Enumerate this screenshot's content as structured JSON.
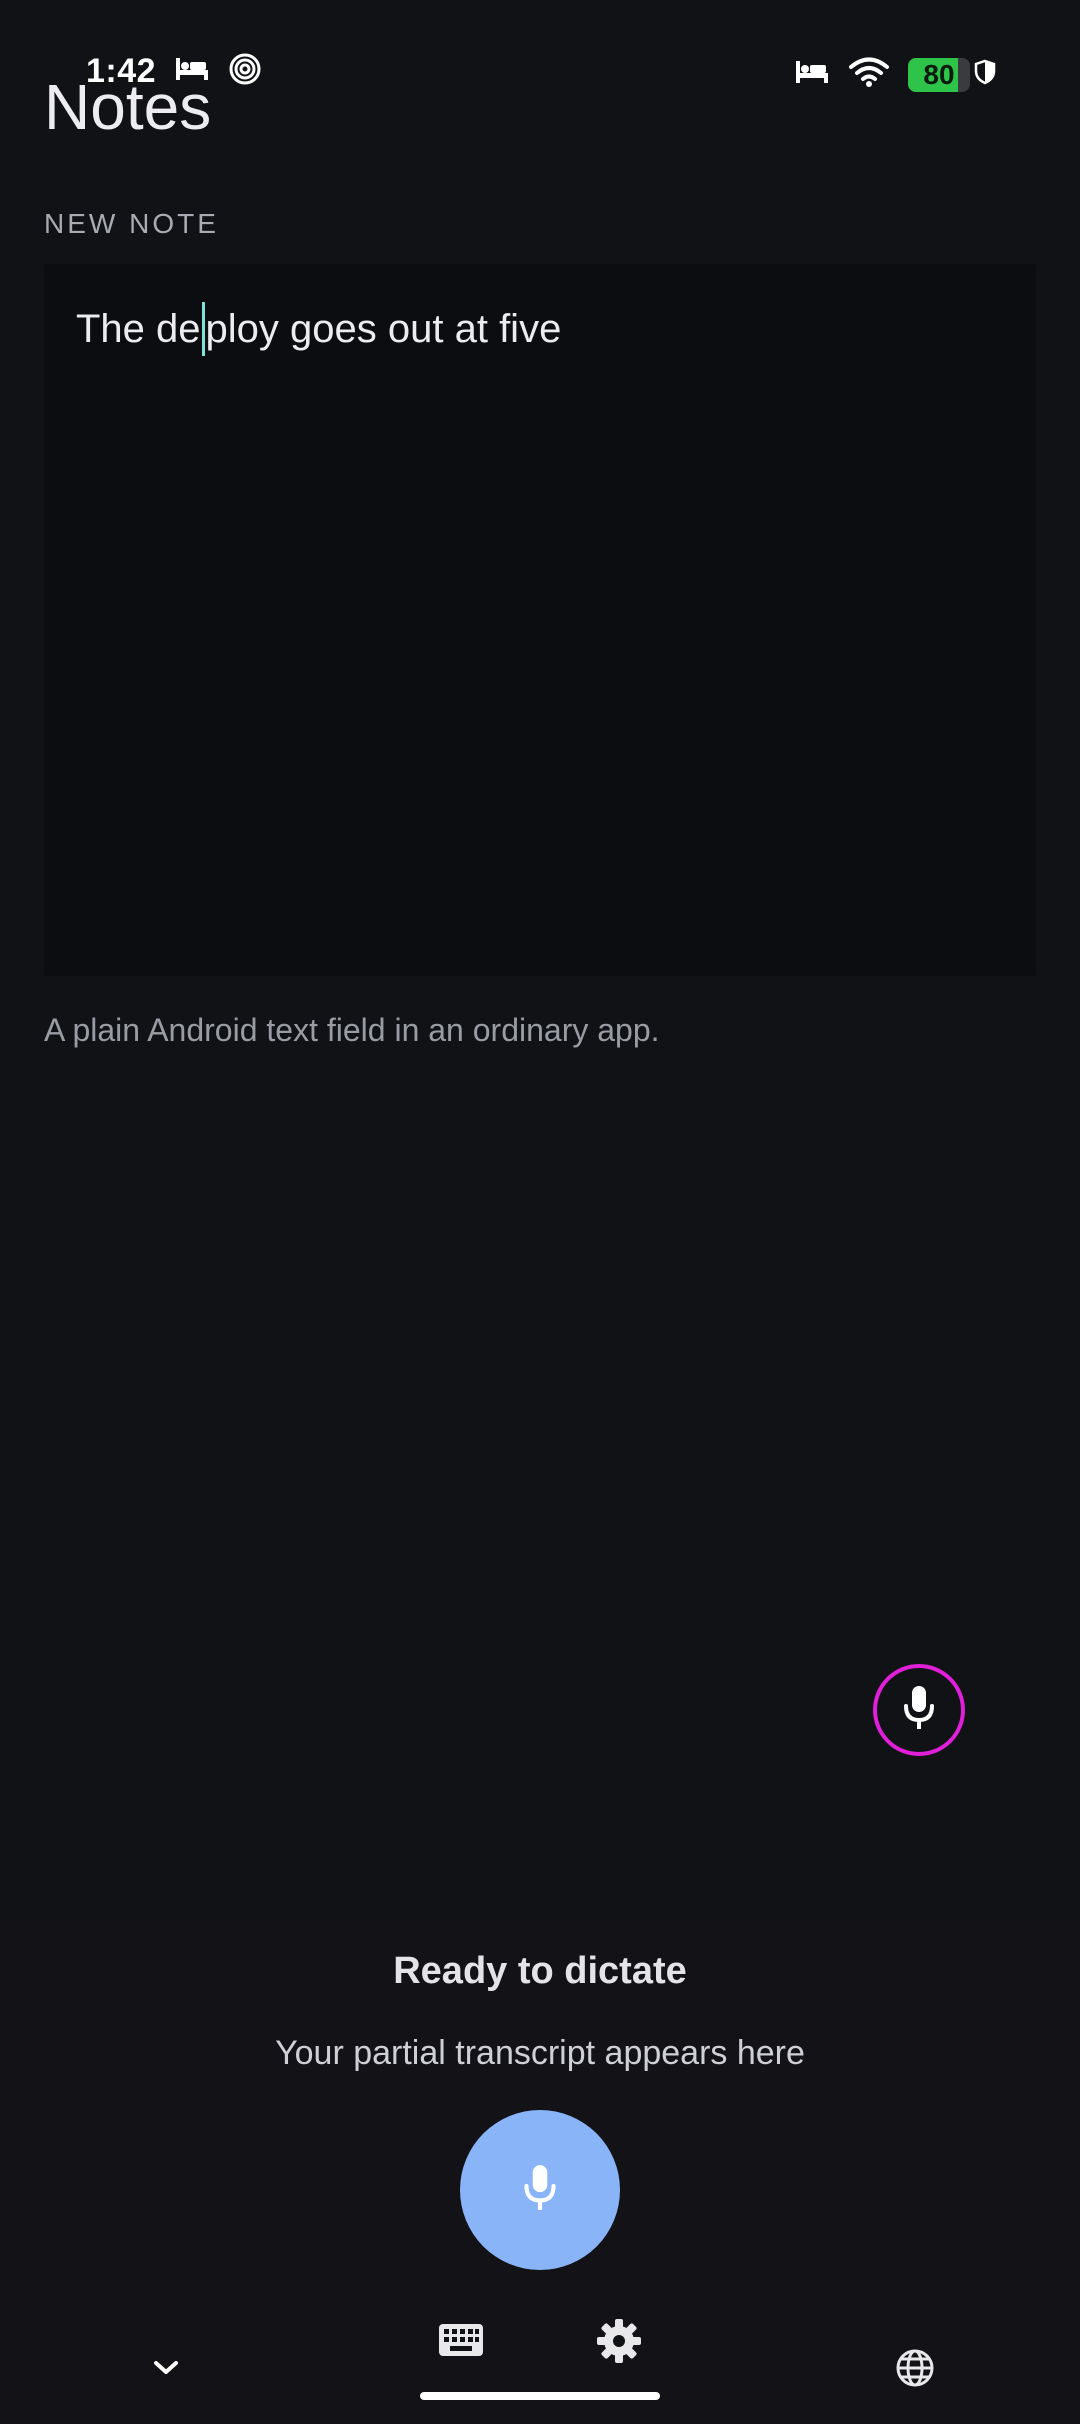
{
  "status_bar": {
    "time": "1:42",
    "battery_level": "80",
    "battery_fraction": 0.8,
    "icons": [
      "bed-icon",
      "spiral-icon",
      "bed-icon",
      "wifi-icon",
      "battery-icon",
      "shield-icon"
    ]
  },
  "app": {
    "title": "Notes",
    "section_label": "NEW NOTE",
    "note": {
      "before_caret": "The de",
      "after_caret": "ploy goes out at five"
    },
    "helper_text": "A plain Android text field in an ordinary app."
  },
  "dictation": {
    "title": "Ready to dictate",
    "partial_placeholder": "Your partial transcript appears here"
  },
  "colors": {
    "background": "#111216",
    "accent_mic": "#8ab4f8",
    "float_mic_ring": "#e01fd8",
    "caret": "#7fe3d8",
    "battery_green": "#2ec44a"
  },
  "bottom_bar": {
    "icons": [
      "chevron-down-icon",
      "keyboard-icon",
      "gear-icon",
      "globe-icon"
    ]
  }
}
